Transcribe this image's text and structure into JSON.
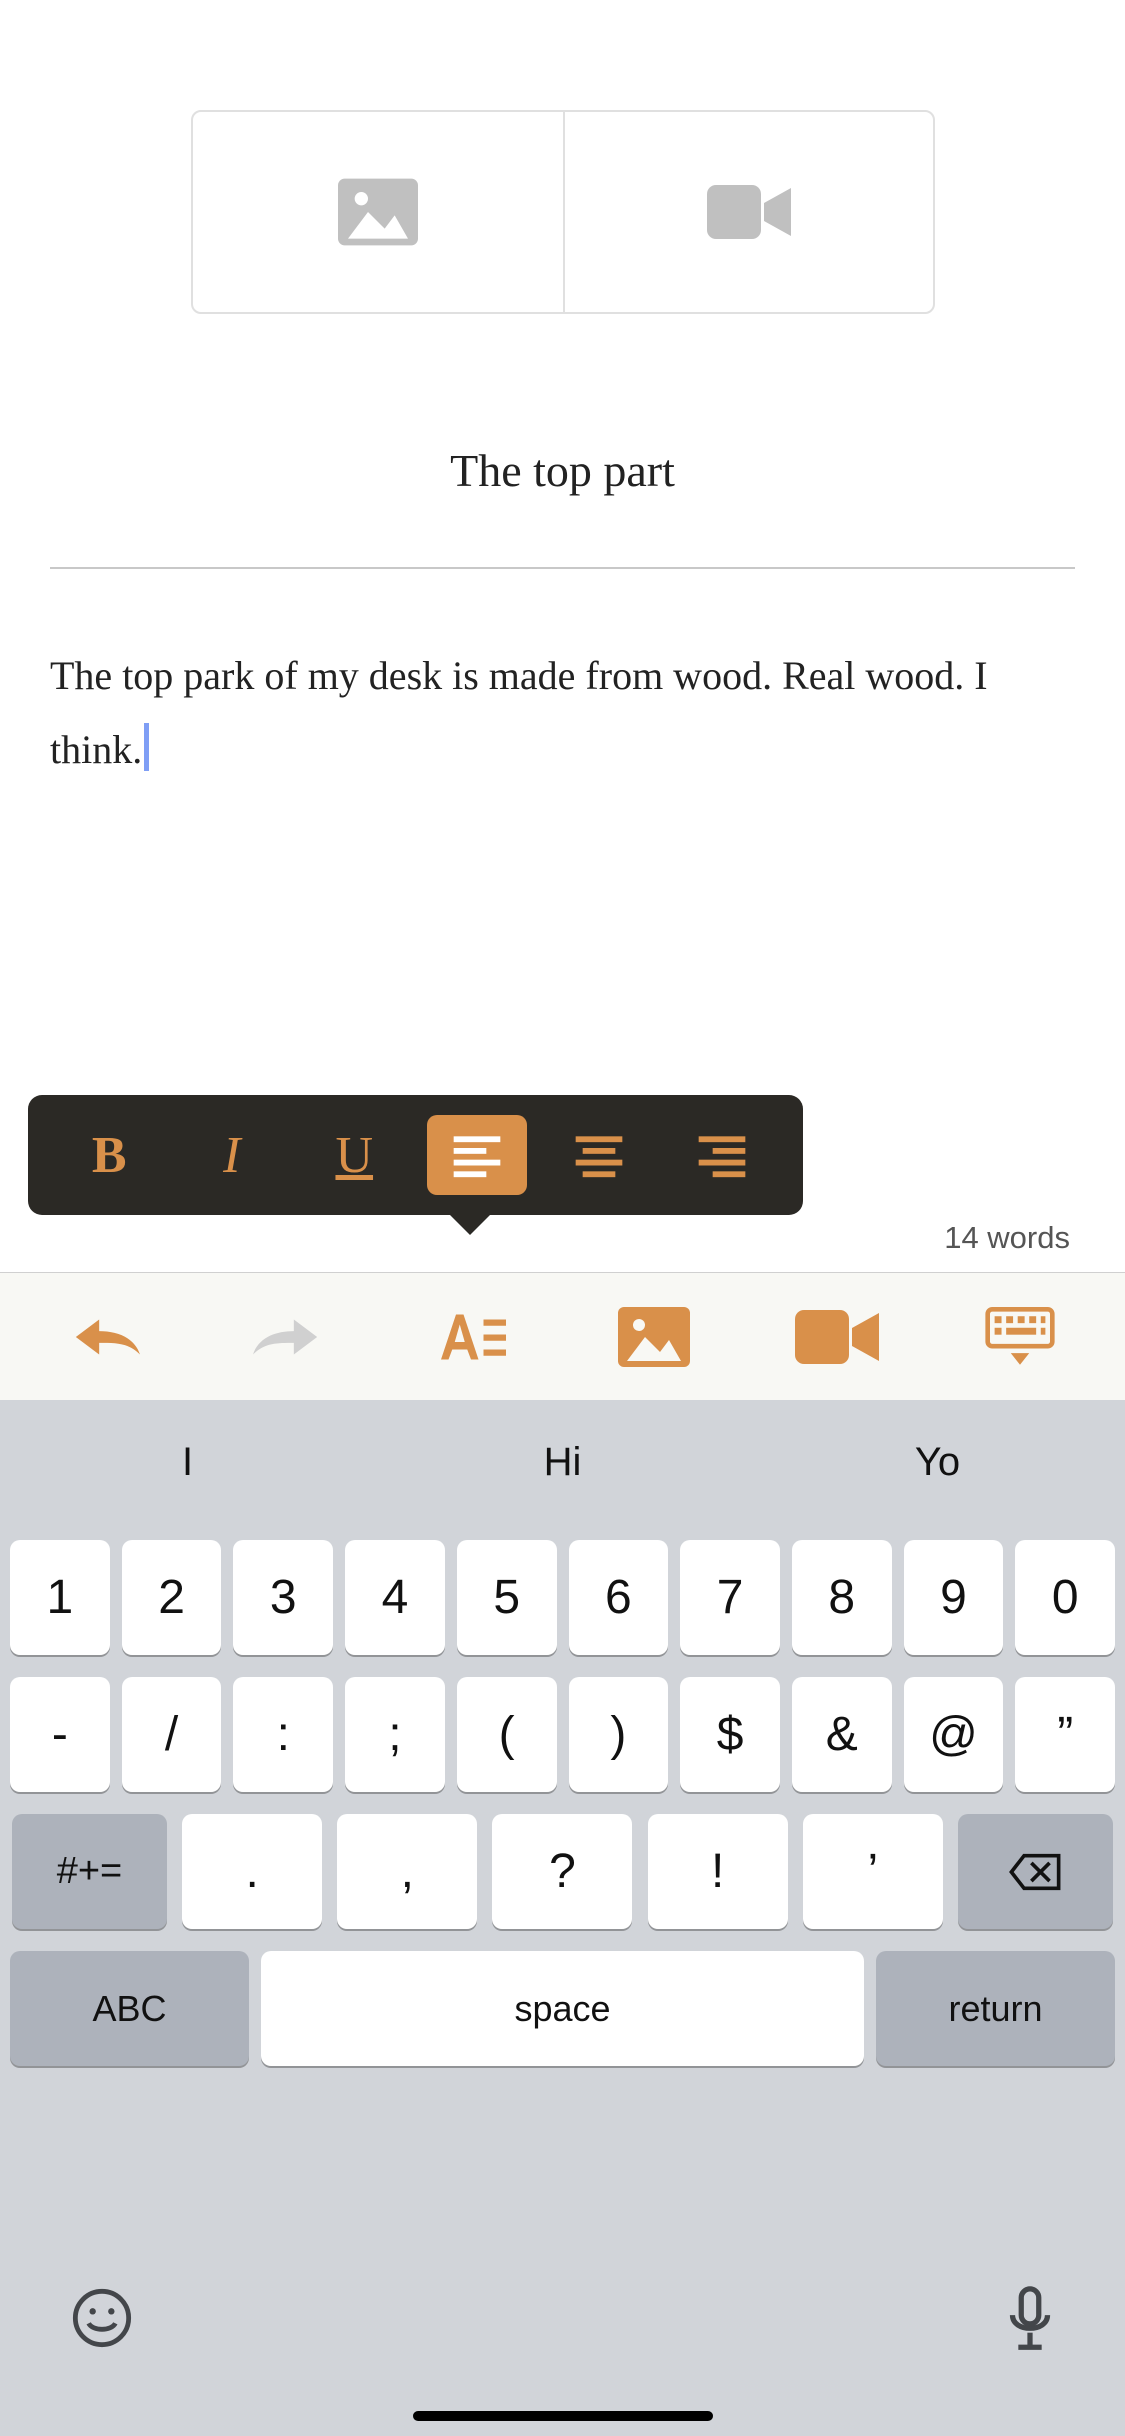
{
  "editor": {
    "title": "The top part",
    "body": "The top park of my desk is made from wood. Real wood. I think."
  },
  "word_count": "14 words",
  "format_toolbar": {
    "bold": "B",
    "italic": "I",
    "underline": "U"
  },
  "suggestions": [
    "I",
    "Hi",
    "Yo"
  ],
  "keyboard": {
    "row1": [
      "1",
      "2",
      "3",
      "4",
      "5",
      "6",
      "7",
      "8",
      "9",
      "0"
    ],
    "row2": [
      "-",
      "/",
      ":",
      ";",
      "(",
      ")",
      "$",
      "&",
      "@",
      "”"
    ],
    "row3_mod": "#+=",
    "row3": [
      ".",
      ",",
      "?",
      "!",
      "’"
    ],
    "abc": "ABC",
    "space": "space",
    "return": "return"
  }
}
